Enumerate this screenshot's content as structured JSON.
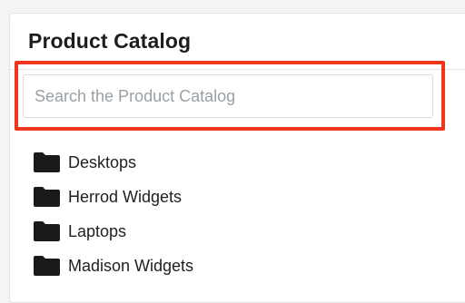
{
  "panel": {
    "title": "Product Catalog"
  },
  "search": {
    "placeholder": "Search the Product Catalog",
    "value": ""
  },
  "tree": {
    "items": [
      {
        "label": "Desktops",
        "icon": "folder-icon"
      },
      {
        "label": "Herrod Widgets",
        "icon": "folder-icon"
      },
      {
        "label": "Laptops",
        "icon": "folder-icon"
      },
      {
        "label": "Madison Widgets",
        "icon": "folder-icon"
      }
    ]
  },
  "colors": {
    "highlight": "#f2361e",
    "folder": "#1a1a1a"
  }
}
